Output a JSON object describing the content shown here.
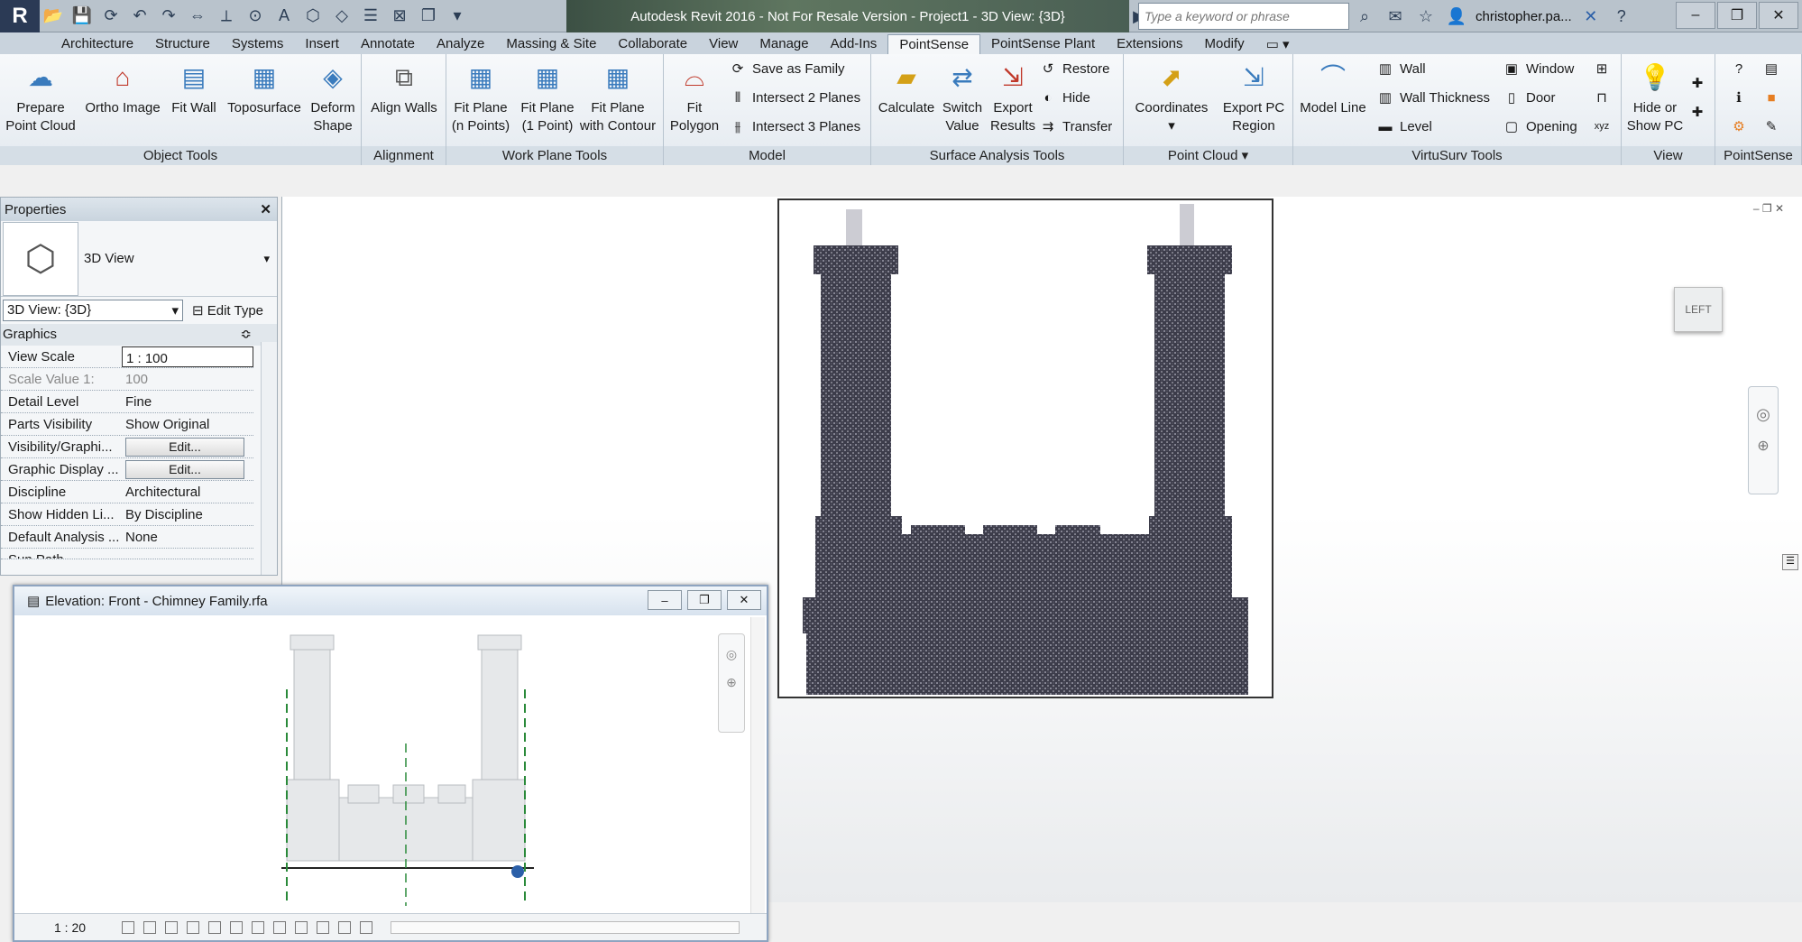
{
  "title": "Autodesk Revit 2016 - Not For Resale Version -    Project1 - 3D View: {3D}",
  "search": {
    "placeholder": "Type a keyword or phrase"
  },
  "user": "christopher.pa...",
  "ribbon_tabs": [
    "Architecture",
    "Structure",
    "Systems",
    "Insert",
    "Annotate",
    "Analyze",
    "Massing & Site",
    "Collaborate",
    "View",
    "Manage",
    "Add-Ins",
    "PointSense",
    "PointSense Plant",
    "Extensions",
    "Modify"
  ],
  "panels": {
    "object_tools": "Object Tools",
    "alignment": "Alignment",
    "work_plane_tools": "Work Plane Tools",
    "model": "Model",
    "surface_analysis_tools": "Surface Analysis Tools",
    "point_cloud": "Point Cloud",
    "virtusurv_tools": "VirtuSurv Tools",
    "view": "View",
    "pointsense": "PointSense"
  },
  "tools": {
    "prepare_point_cloud": [
      "Prepare",
      "Point Cloud"
    ],
    "ortho_image": "Ortho Image",
    "fit_wall": "Fit Wall",
    "toposurface": "Toposurface",
    "deform_shape": [
      "Deform",
      "Shape"
    ],
    "align_walls": "Align Walls",
    "fit_plane_points": [
      "Fit Plane",
      "(n Points)"
    ],
    "fit_plane_1point": [
      "Fit Plane",
      "(1 Point)"
    ],
    "fit_plane_contour": [
      "Fit Plane",
      "with Contour"
    ],
    "fit_polygon": [
      "Fit",
      "Polygon"
    ],
    "save_as_family": "Save as Family",
    "intersect_2_planes": "Intersect 2 Planes",
    "intersect_3_planes": "Intersect 3 Planes",
    "calculate": "Calculate",
    "switch_value": [
      "Switch",
      "Value"
    ],
    "export_results": [
      "Export",
      "Results"
    ],
    "restore": "Restore",
    "hide": "Hide",
    "transfer": "Transfer",
    "coordinates": "Coordinates",
    "export_pc_region": [
      "Export PC",
      "Region"
    ],
    "model_line": "Model Line",
    "wall": "Wall",
    "wall_thickness": "Wall Thickness",
    "level": "Level",
    "window": "Window",
    "door": "Door",
    "opening": "Opening",
    "hide_show_pc": [
      "Hide or",
      "Show PC"
    ]
  },
  "properties": {
    "title": "Properties",
    "type_name": "3D View",
    "view_selector": "3D View: {3D}",
    "edit_type": "Edit Type",
    "section": "Graphics",
    "rows": [
      {
        "k": "View Scale",
        "v": "1 : 100"
      },
      {
        "k": "Scale Value    1:",
        "v": "100"
      },
      {
        "k": "Detail Level",
        "v": "Fine"
      },
      {
        "k": "Parts Visibility",
        "v": "Show Original"
      },
      {
        "k": "Visibility/Graphi...",
        "v": "Edit..."
      },
      {
        "k": "Graphic Display ...",
        "v": "Edit..."
      },
      {
        "k": "Discipline",
        "v": "Architectural"
      },
      {
        "k": "Show Hidden Li...",
        "v": "By Discipline"
      },
      {
        "k": "Default Analysis ...",
        "v": "None"
      },
      {
        "k": "Sun Path",
        "v": ""
      }
    ]
  },
  "view": {
    "cube_label": "LEFT"
  },
  "elevation": {
    "title": "Elevation: Front - Chimney Family.rfa",
    "scale": "1 : 20"
  },
  "colors": {
    "accent": "#2b3a55",
    "ribbon": "#e4eaf0",
    "cloud": "#4a4a5a"
  }
}
